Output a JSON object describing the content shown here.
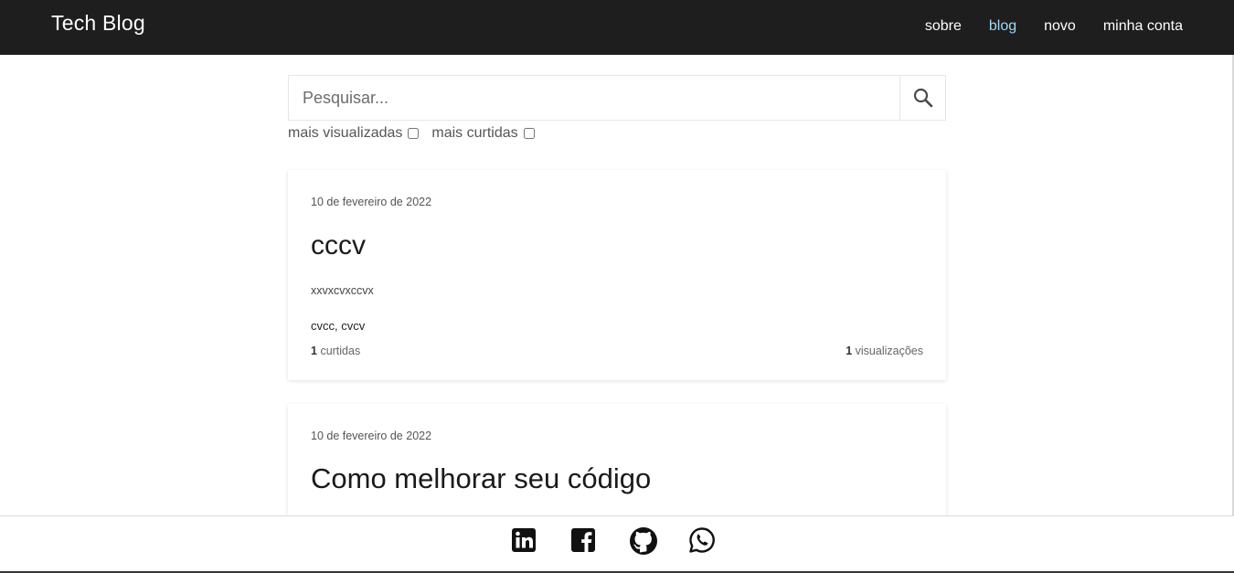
{
  "header": {
    "brand": "Tech Blog",
    "nav": [
      "sobre",
      "blog",
      "novo",
      "minha conta"
    ],
    "active_nav": "blog"
  },
  "search": {
    "placeholder": "Pesquisar...",
    "value": "",
    "icon": "search-icon"
  },
  "filters": [
    {
      "label": "mais visualizadas",
      "checked": false
    },
    {
      "label": "mais curtidas",
      "checked": false
    }
  ],
  "posts": [
    {
      "date": "10 de fevereiro de 2022",
      "title": "cccv",
      "excerpt": "xxvxcvxccvx",
      "tags": "cvcc, cvcv",
      "likes": "1",
      "likes_label": "curtidas",
      "views": "1",
      "views_label": "visualizações"
    },
    {
      "date": "10 de fevereiro de 2022",
      "title": "Como melhorar seu código"
    }
  ],
  "footer": {
    "social_icons": [
      "linkedin-icon",
      "facebook-icon",
      "github-icon",
      "whatsapp-icon"
    ]
  },
  "colors": {
    "header_bg": "#1e1e1e",
    "nav_active": "#9fd8f5"
  }
}
